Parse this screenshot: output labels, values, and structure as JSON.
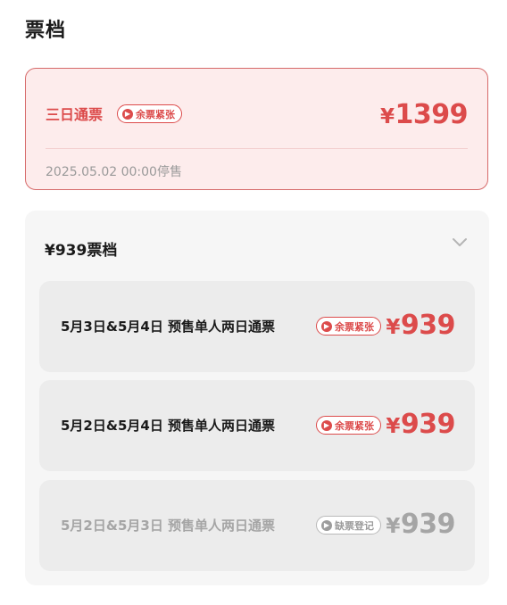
{
  "page": {
    "title": "票档"
  },
  "selected_tier": {
    "name": "三日通票",
    "badge": "余票紧张",
    "currency": "¥",
    "price": "1399",
    "stop_time": "2025.05.02 00:00停售"
  },
  "group": {
    "title": "¥939票档",
    "expand_icon": "chevron-down-icon",
    "options": [
      {
        "label": "5月3日&5月4日 预售单人两日通票",
        "badge": "余票紧张",
        "currency": "¥",
        "price": "939",
        "status": "available"
      },
      {
        "label": "5月2日&5月4日 预售单人两日通票",
        "badge": "余票紧张",
        "currency": "¥",
        "price": "939",
        "status": "available"
      },
      {
        "label": "5月2日&5月3日 预售单人两日通票",
        "badge": "缺票登记",
        "currency": "¥",
        "price": "939",
        "status": "disabled"
      }
    ]
  },
  "colors": {
    "accent": "#dc4b4b",
    "selected_bg": "#fdecec",
    "panel_bg": "#f6f6f6",
    "option_bg": "#ececec",
    "disabled": "#a5a5a5"
  }
}
